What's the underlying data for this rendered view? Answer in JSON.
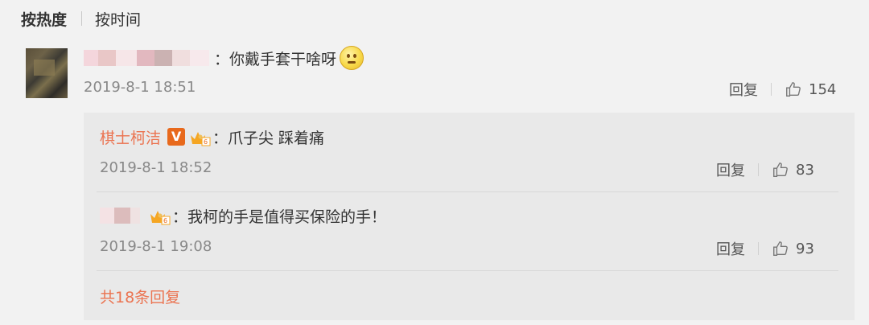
{
  "sort": {
    "hot": "按热度",
    "time": "按时间"
  },
  "comment": {
    "text": "：你戴手套干啥呀",
    "emoji": "smiley-emoji-icon",
    "time": "2019-8-1 18:51",
    "reply_label": "回复",
    "likes": "154"
  },
  "replies": [
    {
      "user": "棋士柯洁",
      "verified_badge": "V",
      "text": "：爪子尖 踩着痛",
      "time": "2019-8-1 18:52",
      "reply_label": "回复",
      "likes": "83"
    },
    {
      "text": "：我柯的手是值得买保险的手！",
      "time": "2019-8-1 19:08",
      "reply_label": "回复",
      "likes": "93"
    }
  ],
  "more_replies": "共18条回复",
  "colors": {
    "accent": "#eb7350",
    "badge": "#e8691c",
    "text": "#333333",
    "muted": "#888888"
  }
}
